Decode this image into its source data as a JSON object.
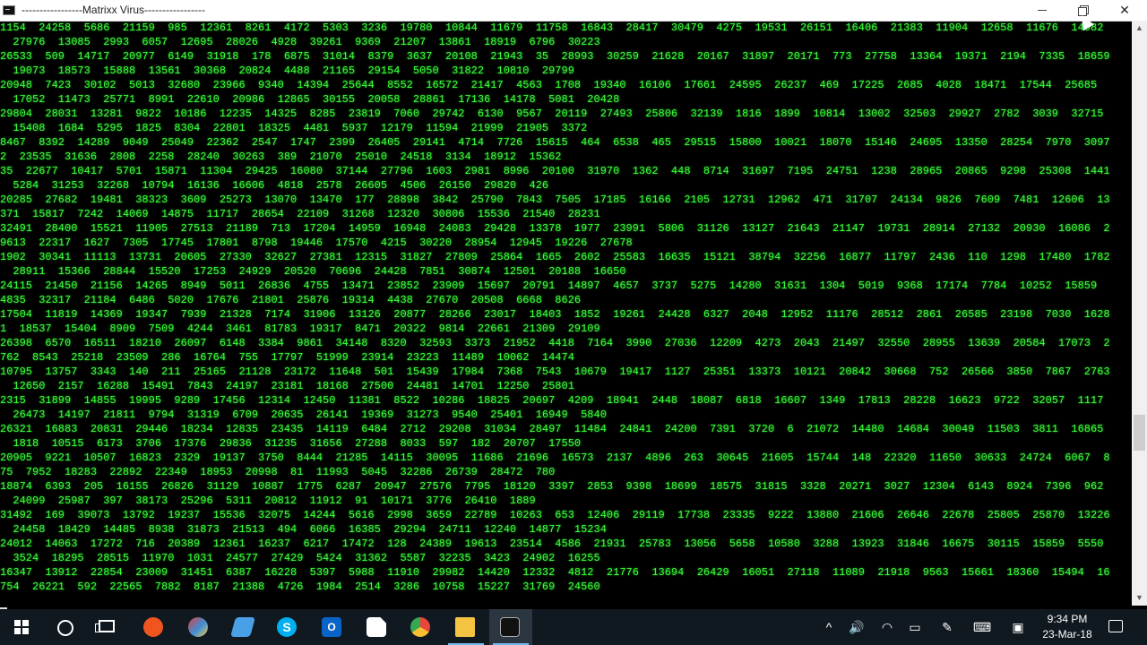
{
  "window": {
    "title": "-----------------Matrixx Virus-----------------",
    "minimize_label": "Minimize",
    "maximize_label": "Restore",
    "close_label": "Close"
  },
  "console": {
    "lines": [
      "1154  24258  5686  21159  985  12361  8261  4172  5303  3236  19780  10844  11679  11758  16843  28417  30479  4275  19531  26151  16406  21383  11904  12658  11676  14082",
      "  27976  13085  2993  6057  12695  28026  4928  39261  9369  21207  13861  18919  6796  30223",
      "26533  509  14717  20977  6149  31918  178  6875  31014  8379  3637  20108  21943  35  28993  30259  21628  20167  31897  20171  773  27758  13364  19371  2194  7335  18659",
      "  19073  18573  15888  13561  30368  20824  4488  21165  29154  5050  31822  10810  29799",
      "20948  7423  30102  5013  32680  23966  9340  14394  25644  8552  16572  21417  4563  1708  19340  16106  17661  24595  26237  469  17225  2685  4028  18471  17544  25685",
      "  17052  11473  25771  8991  22610  20986  12865  30155  20058  28861  17136  14178  5081  20428",
      "29804  28031  13281  9822  10186  12235  14325  8285  23819  7060  29742  6130  9567  20119  27493  25806  32139  1816  1899  10814  13002  32503  29927  2782  3039  32715",
      "  15408  1684  5295  1825  8304  22801  18325  4481  5937  12179  11594  21999  21905  3372",
      "8467  8392  14289  9049  25049  22362  2547  1747  2399  26405  29141  4714  7726  15615  464  6538  465  29515  15800  10021  18070  15146  24695  13350  28254  7970  3097",
      "2  23535  31636  2808  2258  28240  30263  389  21070  25010  24518  3134  18912  15362",
      "35  22677  10417  5701  15871  11304  29425  16080  37144  27796  1603  2981  8996  20100  31970  1362  448  8714  31697  7195  24751  1238  28965  20865  9298  25308  1441",
      "  5284  31253  32268  10794  16136  16606  4818  2578  26605  4506  26150  29820  426",
      "20285  27682  19481  38323  3609  25273  13070  13470  177  28898  3842  25790  7843  7505  17185  16166  2105  12731  12962  471  31707  24134  9826  7609  7481  12606  13",
      "371  15817  7242  14069  14875  11717  28654  22109  31268  12320  30806  15536  21540  28231",
      "32491  28400  15521  11905  27513  21189  713  17204  14959  16948  24083  29428  13378  1977  23991  5806  31126  13127  21643  21147  19731  28914  27132  20930  16086  2",
      "9613  22317  1627  7305  17745  17801  8798  19446  17570  4215  30220  28954  12945  19226  27678",
      "1902  30341  11113  13731  20605  27330  32627  27381  12315  31827  27809  25864  1665  2602  25583  16635  15121  38794  32256  16877  11797  2436  110  1298  17480  1782",
      "  28911  15366  28844  15520  17253  24929  20520  70696  24428  7851  30874  12501  20188  16650",
      "24115  21450  21156  14265  8949  5011  26836  4755  13471  23852  23909  15697  20791  14897  4657  3737  5275  14280  31631  1304  5019  9368  17174  7784  10252  15859",
      "4835  32317  21184  6486  5020  17676  21801  25876  19314  4438  27670  20508  6668  8626",
      "17504  11819  14369  19347  7939  21328  7174  31906  13126  20877  28266  23017  18403  1852  19261  24428  6327  2048  12952  11176  28512  2861  26585  23198  7030  1628",
      "1  18537  15404  8909  7509  4244  3461  81783  19317  8471  20322  9814  22661  21309  29109",
      "26398  6570  16511  18210  26097  6148  3384  9861  34148  8320  32593  3373  21952  4418  7164  3990  27036  12209  4273  2043  21497  32550  28955  13639  20584  17073  2",
      "762  8543  25218  23509  286  16764  755  17797  51999  23914  23223  11489  10062  14474",
      "10795  13757  3343  140  211  25165  21128  23172  11648  501  15439  17984  7368  7543  10679  19417  1127  25351  13373  10121  20842  30668  752  26566  3850  7867  2763",
      "  12650  2157  16288  15491  7843  24197  23181  18168  27500  24481  14701  12250  25801",
      "2315  31899  14855  19995  9289  17456  12314  12450  11381  8522  10286  18825  20697  4209  18941  2448  18087  6818  16607  1349  17813  28228  16623  9722  32057  1117",
      "  26473  14197  21811  9794  31319  6709  20635  26141  19369  31273  9540  25401  16949  5840",
      "26321  16883  20831  29446  18234  12835  23435  14119  6484  2712  29208  31034  28497  11484  24841  24200  7391  3720  6  21072  14480  14684  30049  11503  3811  16865",
      "  1818  10515  6173  3706  17376  29836  31235  31656  27288  8033  597  182  20707  17550",
      "20905  9221  10507  16823  2329  19137  3750  8444  21285  14115  30095  11686  21696  16573  2137  4896  263  30645  21605  15744  148  22320  11650  30633  24724  6067  8",
      "75  7952  18283  22892  22349  18953  20998  81  11993  5045  32286  26739  28472  780",
      "18874  6393  205  16155  26826  31129  10887  1775  6287  20947  27576  7795  18120  3397  2853  9398  18699  18575  31815  3328  20271  3027  12304  6143  8924  7396  962",
      "  24099  25987  397  38173  25296  5311  20812  11912  91  10171  3776  26410  1889",
      "31492  169  39073  13792  19237  15536  32075  14244  5616  2998  3659  22789  10263  653  12406  29119  17738  23335  9222  13880  21606  26646  22678  25805  25870  13226",
      "  24458  18429  14485  8938  31873  21513  494  6066  16385  29294  24711  12240  14877  15234",
      "24012  14063  17272  716  20389  12361  16237  6217  17472  128  24389  19613  23514  4586  21931  25783  13056  5658  10580  3288  13923  31846  16675  30115  15859  5550",
      "  3524  18295  28515  11970  1031  24577  27429  5424  31362  5587  32235  3423  24902  16255",
      "16347  13912  22854  23009  31451  6387  16228  5397  5988  11910  29982  14420  12332  4812  21776  13694  26429  16051  27118  11089  21918  9563  15661  18360  15494  16",
      "754  26221  592  22565  7882  8187  21388  4726  1984  2514  3286  10758  15227  31769  24560"
    ]
  },
  "scrollbar": {
    "up_glyph": "▲",
    "down_glyph": "▼"
  },
  "taskbar": {
    "apps": [
      {
        "name": "start",
        "color": "#ffffff"
      },
      {
        "name": "cortana",
        "color": "#ffffff"
      },
      {
        "name": "task-view",
        "color": "#ffffff"
      },
      {
        "name": "orange-app",
        "color": "#f0551f"
      },
      {
        "name": "paint-app",
        "color": "#3c8fd8"
      },
      {
        "name": "notepad-app",
        "color": "#4aa0e6"
      },
      {
        "name": "skype-app",
        "color": "#00aff0"
      },
      {
        "name": "outlook-app",
        "color": "#0a64c8"
      },
      {
        "name": "file-app",
        "color": "#ffffff"
      },
      {
        "name": "chrome-app",
        "color": "#e8453c"
      },
      {
        "name": "explorer-app",
        "color": "#f5c342"
      },
      {
        "name": "cmd-app",
        "color": "#222222"
      }
    ],
    "tray": {
      "chevron_glyph": "^",
      "volume_glyph": "🔊",
      "wifi_glyph": "◠",
      "battery_glyph": "▭",
      "pen_glyph": "✎",
      "keyboard_glyph": "⌨",
      "display_glyph": "▣"
    },
    "clock": {
      "time": "9:34 PM",
      "date": "23-Mar-18"
    }
  }
}
